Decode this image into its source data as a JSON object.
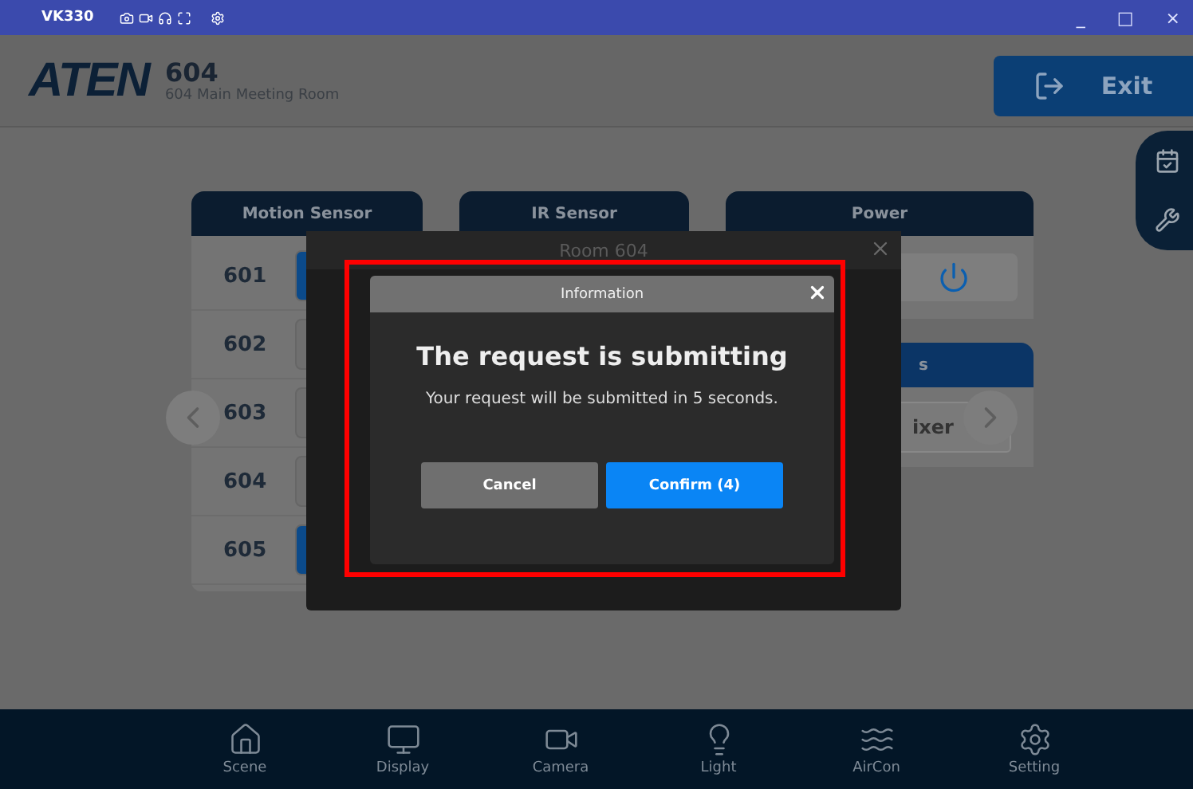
{
  "window": {
    "title": "VK330",
    "controls": [
      "_",
      "□",
      "×"
    ]
  },
  "header": {
    "logo": "ATEN",
    "room_number": "604",
    "room_name": "604 Main Meeting Room",
    "exit_label": "Exit"
  },
  "cards": [
    {
      "kind": "sensor",
      "title": "Motion Sensor",
      "rows": [
        {
          "label": "601",
          "on": true
        },
        {
          "label": "602",
          "on": false
        },
        {
          "label": "603",
          "on": false
        },
        {
          "label": "604",
          "on": false
        },
        {
          "label": "605",
          "on": true
        }
      ]
    },
    {
      "kind": "header",
      "title": "IR Sensor"
    },
    {
      "kind": "power",
      "title": "Power"
    }
  ],
  "second_panel": {
    "title": "s",
    "button": "ixer"
  },
  "room_dialog": {
    "title": "Room 604"
  },
  "info_dialog": {
    "title": "Information",
    "heading": "The request is submitting",
    "message": "Your request will be submitted in 5 seconds.",
    "buttons": [
      {
        "label": "Cancel",
        "kind": "secondary"
      },
      {
        "label": "Confirm (4)",
        "kind": "primary"
      }
    ]
  },
  "nav": [
    {
      "label": "Scene"
    },
    {
      "label": "Display"
    },
    {
      "label": "Camera"
    },
    {
      "label": "Light"
    },
    {
      "label": "AirCon"
    },
    {
      "label": "Setting"
    }
  ]
}
